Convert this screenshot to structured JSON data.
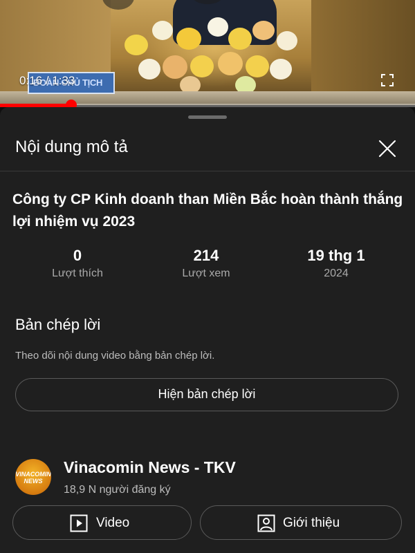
{
  "player": {
    "current_time": "0:16",
    "duration": "1:33",
    "progress_fraction": 0.172,
    "nameplate_text": "ĐOÀN CHỦ TỊCH",
    "accent_color": "#ff0000"
  },
  "sheet": {
    "title": "Nội dung mô tả",
    "close_icon": "close-icon"
  },
  "video": {
    "title": "Công ty CP Kinh doanh than Miền Bắc hoàn thành thắng lợi nhiệm vụ 2023"
  },
  "stats": [
    {
      "value": "0",
      "label": "Lượt thích"
    },
    {
      "value": "214",
      "label": "Lượt xem"
    },
    {
      "value": "19 thg 1",
      "label": "2024"
    }
  ],
  "transcript": {
    "title": "Bản chép lời",
    "description": "Theo dõi nội dung video bằng bản chép lời.",
    "button_label": "Hiện bản chép lời"
  },
  "channel": {
    "name": "Vinacomin News - TKV",
    "subscribers": "18,9 N người đăng ký",
    "avatar_text_1": "VINACOMIN",
    "avatar_text_2": "NEWS",
    "buttons": [
      {
        "label": "Video",
        "icon": "play-box-icon"
      },
      {
        "label": "Giới thiệu",
        "icon": "person-box-icon"
      }
    ]
  }
}
